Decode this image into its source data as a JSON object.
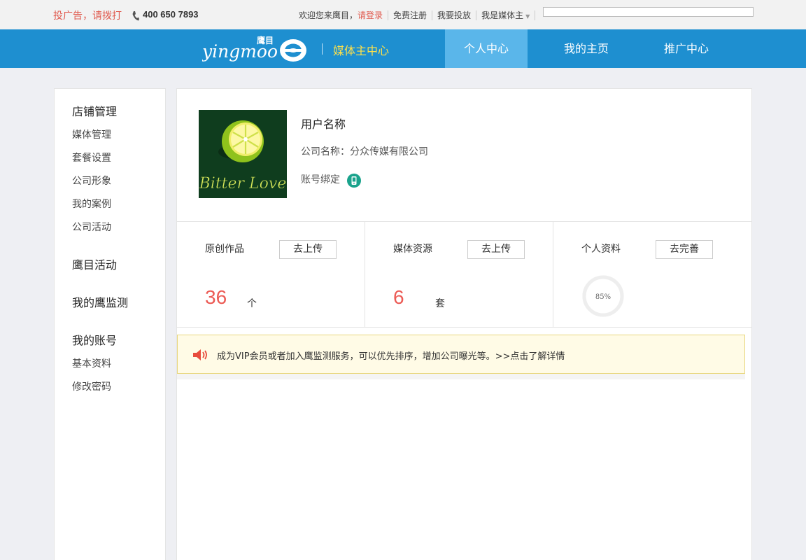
{
  "topbar": {
    "ad_text": "投广告，请拨打",
    "phone": "400 650 7893",
    "welcome": "欢迎您来鹰目，",
    "login": "请登录",
    "register": "免费注册",
    "advertise": "我要投放",
    "media_owner": "我是媒体主"
  },
  "nav": {
    "logo_alt": "yingmoo 鹰目",
    "subtitle": "媒体主中心",
    "tabs": [
      {
        "label": "个人中心",
        "active": true
      },
      {
        "label": "我的主页",
        "active": false
      },
      {
        "label": "推广中心",
        "active": false
      }
    ]
  },
  "sidebar": {
    "sections": [
      {
        "title": "店铺管理",
        "items": [
          "媒体管理",
          "套餐设置",
          "公司形象",
          "我的案例",
          "公司活动"
        ]
      },
      {
        "title": "鹰目活动",
        "items": []
      },
      {
        "title": "我的鹰监测",
        "items": []
      },
      {
        "title": "我的账号",
        "items": [
          "基本资料",
          "修改密码"
        ]
      }
    ]
  },
  "profile": {
    "logo_text": "Bitter Love",
    "user_name": "用户名称",
    "company": "公司名称：分众传媒有限公司",
    "binding": "账号绑定"
  },
  "stats": [
    {
      "label": "原创作品",
      "button": "去上传",
      "value": "36",
      "unit": "个"
    },
    {
      "label": "媒体资源",
      "button": "去上传",
      "value": "6",
      "unit": "套"
    },
    {
      "label": "个人资料",
      "button": "去完善",
      "percent_text": "85%",
      "percent": 0.85
    }
  ],
  "notice": {
    "text": "成为VIP会员或者加入鹰监测服务，可以优先排序，增加公司曝光等。>>点击了解详情"
  },
  "colors": {
    "nav_blue": "#1e8fd0",
    "nav_active": "#5ab6ea",
    "accent_red": "#ec5b55",
    "nav_subtitle": "#ffe14a"
  }
}
